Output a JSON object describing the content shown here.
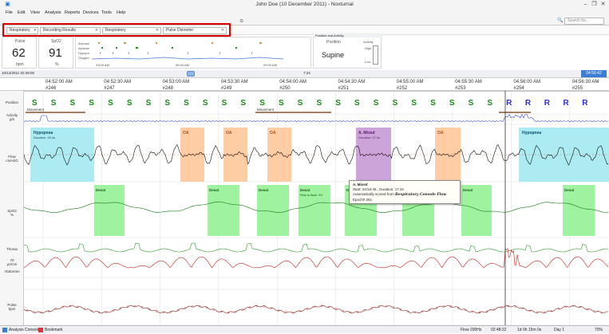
{
  "window": {
    "title": "John Doe (10 December 2011) - Noxturnal"
  },
  "menu": [
    "File",
    "Edit",
    "View",
    "Analysis",
    "Reports",
    "Devices",
    "Tools",
    "Help"
  ],
  "search": {
    "placeholder": "Search for..."
  },
  "tabs": {
    "dropdown": "Respiratory",
    "recording": "Recording Results",
    "respiratory": "Respiratory",
    "oximeter": "Pulse Oximeter"
  },
  "values": {
    "pulse_label": "Pulse",
    "pulse_value": "62",
    "pulse_unit": "bpm",
    "spo2_label": "SpO2",
    "spo2_value": "91",
    "spo2_unit": "%"
  },
  "overview": {
    "rows": [
      "Arousal",
      "Apneas",
      "Hypopn",
      "Oxygen"
    ],
    "times": [
      "03:00 AM",
      "06:00 AM",
      "09:00 AM"
    ]
  },
  "position": {
    "header": "Position and Activity",
    "label": "Position",
    "activity_label": "Activity",
    "value": "Supine",
    "high": "High",
    "low": "Low"
  },
  "timeline": {
    "date": "10/12/2011 02:48:00",
    "nav_label": "7:24",
    "times": [
      "04:52:00 AM",
      "04:52:30 AM",
      "04:53:00 AM",
      "04:53:30 AM",
      "04:54:00 AM",
      "04:54:30 AM",
      "04:55:00 AM",
      "04:55:30 AM",
      "04:56:00 AM",
      "04:56:30 AM"
    ],
    "epochs": [
      "#246",
      "#247",
      "#248",
      "#249",
      "#250",
      "#251",
      "#252",
      "#253",
      "#254",
      "#255"
    ],
    "right_time": "04:56:42"
  },
  "channels": {
    "position": "Position",
    "activity": "Activity\ng/s",
    "flow": "Flow\ncmH2O",
    "spo2": "SpO2\n%",
    "thorax": "Thorax",
    "abdomen": "Abdomen",
    "abd_unit": "70\nμV/cm",
    "pulse": "Pulse\nbpm"
  },
  "position_marks": [
    "S",
    "S",
    "S",
    "S",
    "S",
    "S",
    "S",
    "S",
    "S",
    "S",
    "S",
    "S",
    "S",
    "S",
    "S",
    "S",
    "S",
    "S",
    "S",
    "S",
    "S",
    "S",
    "S",
    "S",
    "S",
    "R",
    "R",
    "R",
    "R",
    "R"
  ],
  "events": {
    "movement": "Movement",
    "hypopnea": "Hypopnea",
    "hypo_dur": "Duration: 33.4s",
    "oa": "OA",
    "mixed": "A. Mixed",
    "mixed_dur": "Duration: 17.2s",
    "desat": "Desat",
    "desat_drop": "Peak to Nadir: 9%"
  },
  "tooltip": {
    "title": "A. Mixed",
    "line1": "Start: 04:54:45 , Duration: 17.2s",
    "line2_prefix": "Automatically scored from",
    "line2_script": "Respiratory Console Flow",
    "line3": "Epoch# 251"
  },
  "y_ticks": {
    "activity": [
      "0.5",
      "0"
    ],
    "flow": [
      "0.6",
      "0.4",
      "0.2",
      "0",
      "-0.2",
      "-0.4"
    ],
    "spo2": [
      "100",
      "95",
      "90",
      "85"
    ],
    "pulse": [
      "100",
      "90",
      "80",
      "70",
      "60"
    ]
  },
  "status": {
    "console": "Analysis Console",
    "bookmark": "Bookmark",
    "flow": "Flow 200Hz",
    "time": "02:48:22",
    "duration": "1d 0h 15m 0s",
    "day": "Day 1",
    "zoom": "70%"
  }
}
